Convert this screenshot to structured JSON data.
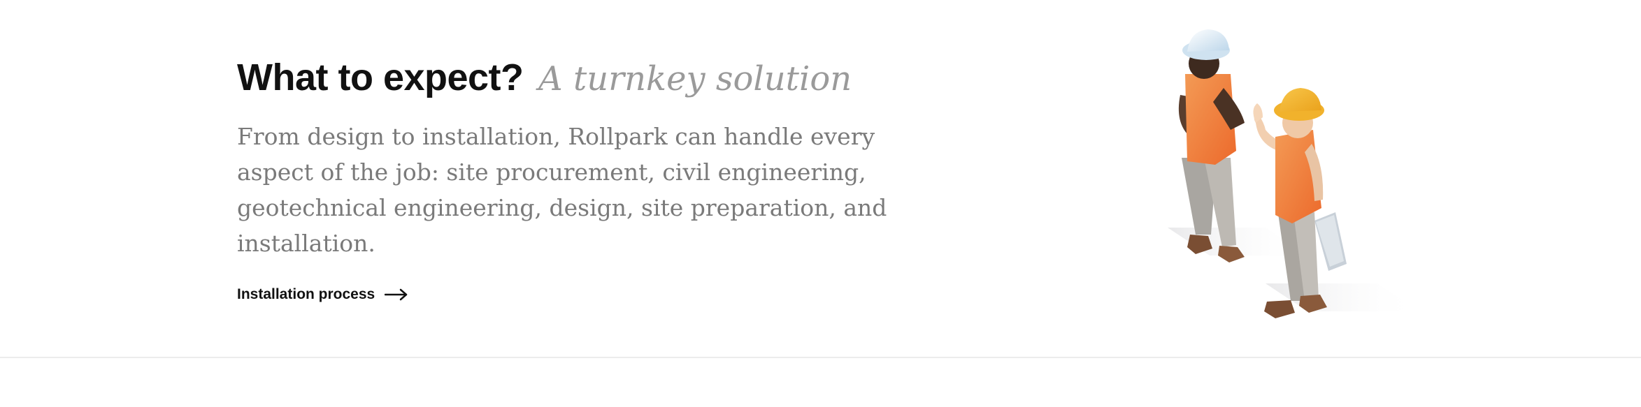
{
  "section": {
    "headline": "What to expect?",
    "headline_accent": "A turnkey solution",
    "body": "From design to installation, Rollpark can handle every aspect of the job: site procurement, civil engineering, geotechnical engineering, design, site preparation, and installation.",
    "cta_label": "Installation process",
    "cta_icon": "arrow-right-icon"
  },
  "illustration": {
    "subject": "workers-illustration",
    "colors": {
      "vest": "#f0803c",
      "helmet_white": "#e8f0f6",
      "helmet_yellow": "#f4b532",
      "pants": "#b8b4ae",
      "boots": "#7a4e33"
    }
  }
}
